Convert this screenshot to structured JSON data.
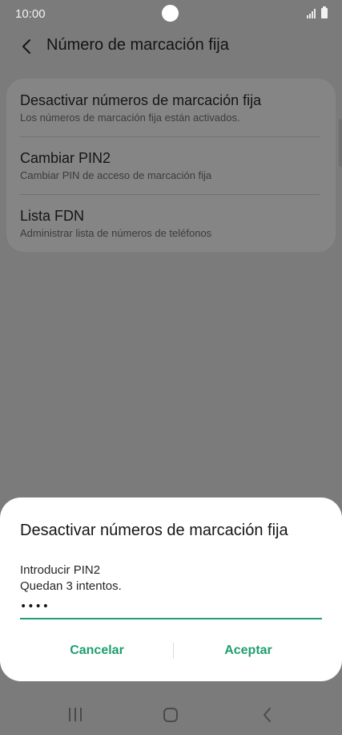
{
  "status_bar": {
    "time": "10:00",
    "icons": [
      "signal-icon",
      "battery-icon"
    ]
  },
  "header": {
    "title": "Número de marcación fija",
    "back_icon": "chevron-left-icon"
  },
  "settings": {
    "items": [
      {
        "title": "Desactivar números de marcación fija",
        "subtitle": "Los números de marcación fija están activados."
      },
      {
        "title": "Cambiar PIN2",
        "subtitle": "Cambiar PIN de acceso de marcación fija"
      },
      {
        "title": "Lista FDN",
        "subtitle": "Administrar lista de números de teléfonos"
      }
    ]
  },
  "dialog": {
    "title": "Desactivar números de marcación fija",
    "pin_label": "Introducir PIN2",
    "attempts_text": "Quedan 3 intentos.",
    "pin_value": "••••",
    "cancel_label": "Cancelar",
    "accept_label": "Aceptar"
  },
  "nav_bar": {
    "icons": [
      "recents-icon",
      "home-icon",
      "back-icon"
    ]
  },
  "colors": {
    "accent": "#1f9e6e",
    "scrim": "#7b7b7b",
    "dialog_bg": "#ffffff"
  }
}
